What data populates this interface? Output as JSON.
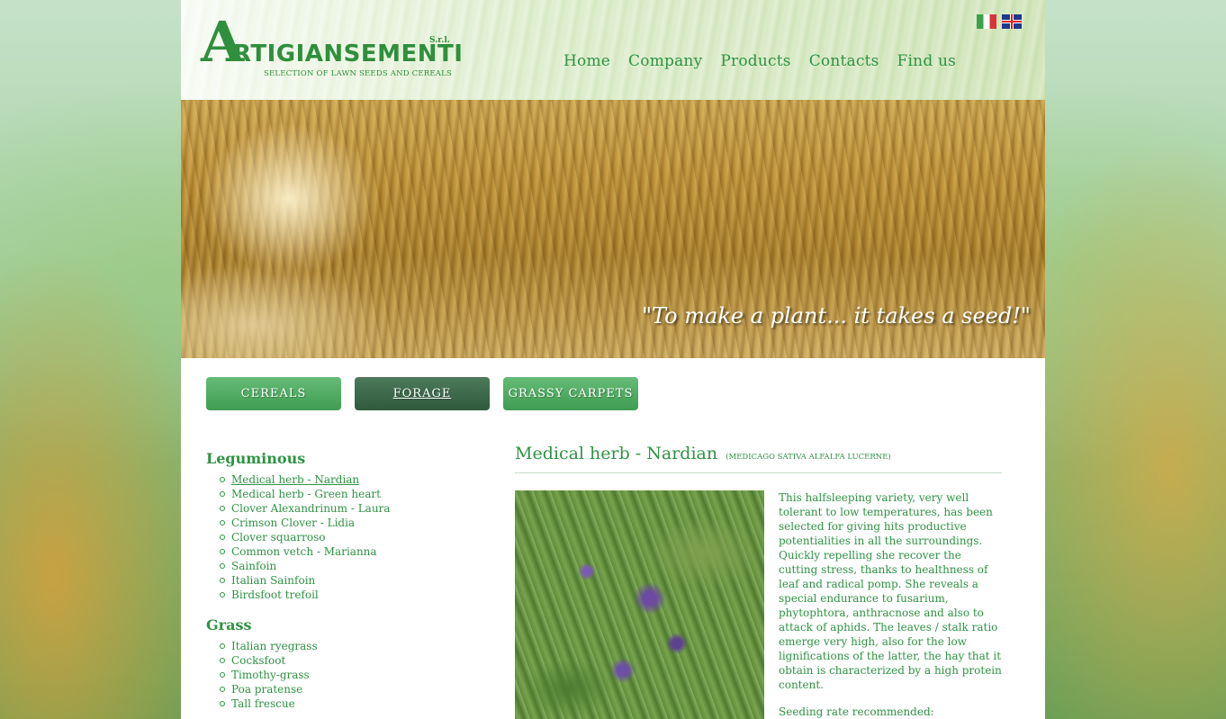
{
  "header": {
    "logo_initial": "A",
    "logo_name": "RTIGIANSEMENTI",
    "logo_srl": "S.r.l.",
    "logo_tagline": "SELECTION OF LAWN SEEDS AND CEREALS",
    "languages": [
      {
        "name": "italian-flag-icon"
      },
      {
        "name": "english-flag-icon"
      }
    ],
    "nav": [
      "Home",
      "Company",
      "Products",
      "Contacts",
      "Find us"
    ]
  },
  "banner": {
    "quote": "\"To make a plant... it takes a seed!\""
  },
  "categories": [
    {
      "label": "CEREALS",
      "active": false
    },
    {
      "label": "FORAGE",
      "active": true
    },
    {
      "label": "GRASSY CARPETS",
      "active": false
    }
  ],
  "sidebar": {
    "groups": [
      {
        "heading": "Leguminous",
        "items": [
          "Medical herb - Nardian",
          "Medical herb - Green heart",
          "Clover Alexandrinum - Laura",
          "Crimson Clover - Lidia",
          "Clover squarroso",
          "Common vetch - Marianna",
          "Sainfoin",
          "Italian Sainfoin",
          "Birdsfoot trefoil"
        ]
      },
      {
        "heading": "Grass",
        "items": [
          "Italian ryegrass",
          "Cocksfoot",
          "Timothy-grass",
          "Poa pratense",
          "Tall frescue"
        ]
      }
    ]
  },
  "product": {
    "title": "Medical herb - Nardian",
    "subtitle": "(MEDICAGO SATIVA ALFALFA LUCERNE)",
    "description": "This halfsleeping variety, very well tolerant to low temperatures, has been selected for giving hits productive potentialities in all the surroundings. Quickly repelling she recover the cutting stress, thanks to healthness of leaf and radical pomp. She reveals a special endurance to fusarium, phytophtora, anthracnose and also to attack of aphids. The leaves / stalk ratio emerge very high, also for the low lignifications of the latter, the hay that it obtain is characterized by a high protein content.",
    "seeding_label": "Seeding rate recommended:"
  }
}
